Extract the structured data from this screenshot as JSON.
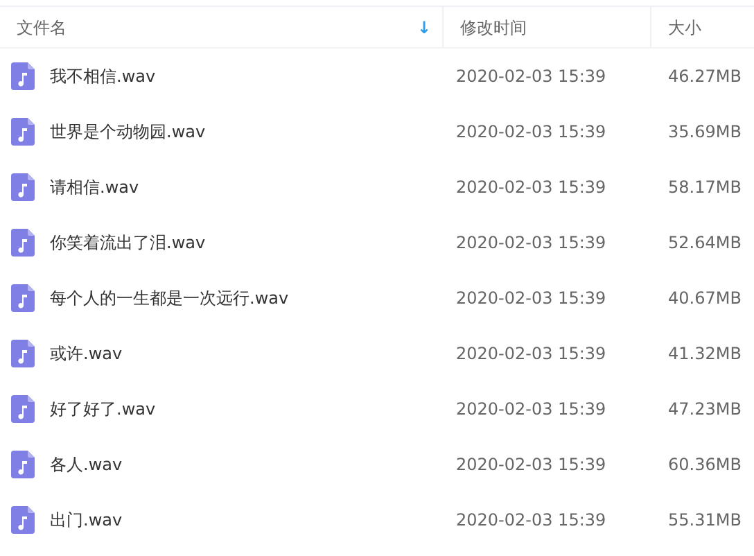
{
  "columns": [
    {
      "label": "文件名",
      "sort_arrow": "↓"
    },
    {
      "label": "修改时间"
    },
    {
      "label": "大小"
    }
  ],
  "rows": [
    {
      "name": "我不相信.wav",
      "modified": "2020-02-03 15:39",
      "size": "46.27MB"
    },
    {
      "name": "世界是个动物园.wav",
      "modified": "2020-02-03 15:39",
      "size": "35.69MB"
    },
    {
      "name": "请相信.wav",
      "modified": "2020-02-03 15:39",
      "size": "58.17MB"
    },
    {
      "name": "你笑着流出了泪.wav",
      "modified": "2020-02-03 15:39",
      "size": "52.64MB"
    },
    {
      "name": "每个人的一生都是一次远行.wav",
      "modified": "2020-02-03 15:39",
      "size": "40.67MB"
    },
    {
      "name": "或许.wav",
      "modified": "2020-02-03 15:39",
      "size": "41.32MB"
    },
    {
      "name": "好了好了.wav",
      "modified": "2020-02-03 15:39",
      "size": "47.23MB"
    },
    {
      "name": "各人.wav",
      "modified": "2020-02-03 15:39",
      "size": "60.36MB"
    },
    {
      "name": "出门.wav",
      "modified": "2020-02-03 15:39",
      "size": "55.31MB"
    }
  ]
}
